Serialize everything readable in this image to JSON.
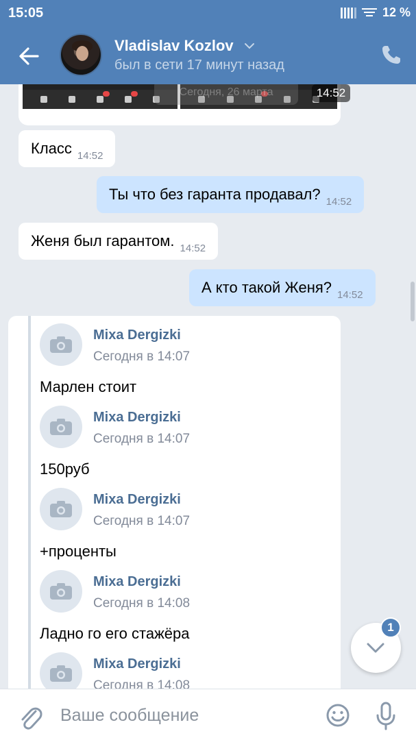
{
  "status_bar": {
    "time": "15:05",
    "battery": "12 %"
  },
  "header": {
    "contact_name": "Vladislav Kozlov",
    "last_seen": "был в сети 17 минут назад"
  },
  "images_block": {
    "date_overlay": "Сегодня, 26 марта",
    "time": "14:52"
  },
  "messages": [
    {
      "direction": "in",
      "text": "Класс",
      "time": "14:52"
    },
    {
      "direction": "out",
      "text": "Ты что без гаранта продавал?",
      "time": "14:52"
    },
    {
      "direction": "in",
      "text": "Женя был гарантом.",
      "time": "14:52"
    },
    {
      "direction": "out",
      "text": "А кто такой Женя?",
      "time": "14:52"
    }
  ],
  "forwarded": [
    {
      "author": "Mixa Dergizki",
      "date": "Сегодня в 14:07",
      "text": "Марлен стоит"
    },
    {
      "author": "Mixa Dergizki",
      "date": "Сегодня в 14:07",
      "text": "150руб"
    },
    {
      "author": "Mixa Dergizki",
      "date": "Сегодня в 14:07",
      "text": "+проценты"
    },
    {
      "author": "Mixa Dergizki",
      "date": "Сегодня в 14:08",
      "text": "Ладно го его стажёра"
    },
    {
      "author": "Mixa Dergizki",
      "date": "Сегодня в 14:08",
      "text": ""
    }
  ],
  "scroll_down": {
    "unread_count": "1"
  },
  "composer": {
    "placeholder": "Ваше сообщение"
  },
  "colors": {
    "header": "#5181b8",
    "background": "#e7ebf0",
    "outgoing_bubble": "#cce4ff",
    "author": "#4a6d93"
  },
  "icons": [
    "back-arrow-icon",
    "chevron-down-icon",
    "phone-icon",
    "camera-icon",
    "chevron-down-icon",
    "paperclip-icon",
    "emoji-icon",
    "microphone-icon"
  ]
}
